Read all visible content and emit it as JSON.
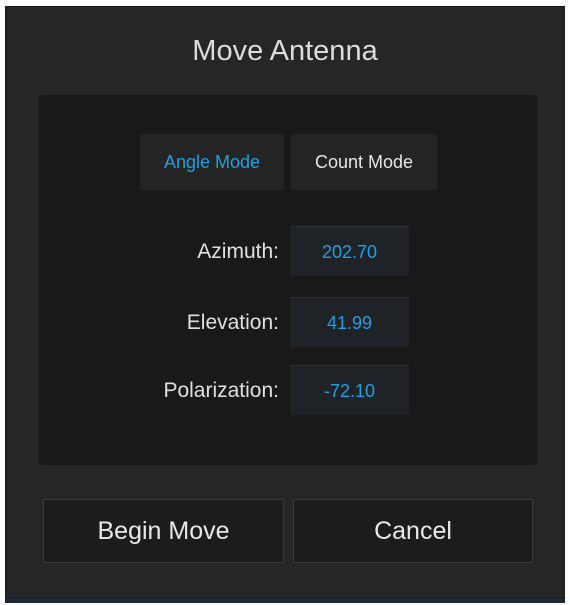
{
  "dialog": {
    "title": "Move Antenna"
  },
  "modes": {
    "angle_label": "Angle Mode",
    "count_label": "Count Mode",
    "selected": "Angle Mode"
  },
  "fields": [
    {
      "label": "Azimuth:",
      "value": "202.70"
    },
    {
      "label": "Elevation:",
      "value": "41.99"
    },
    {
      "label": "Polarization:",
      "value": "-72.10"
    }
  ],
  "actions": {
    "begin_label": "Begin Move",
    "cancel_label": "Cancel"
  },
  "colors": {
    "accent": "#1da1e2",
    "background": "#262626",
    "panel": "#191919"
  }
}
